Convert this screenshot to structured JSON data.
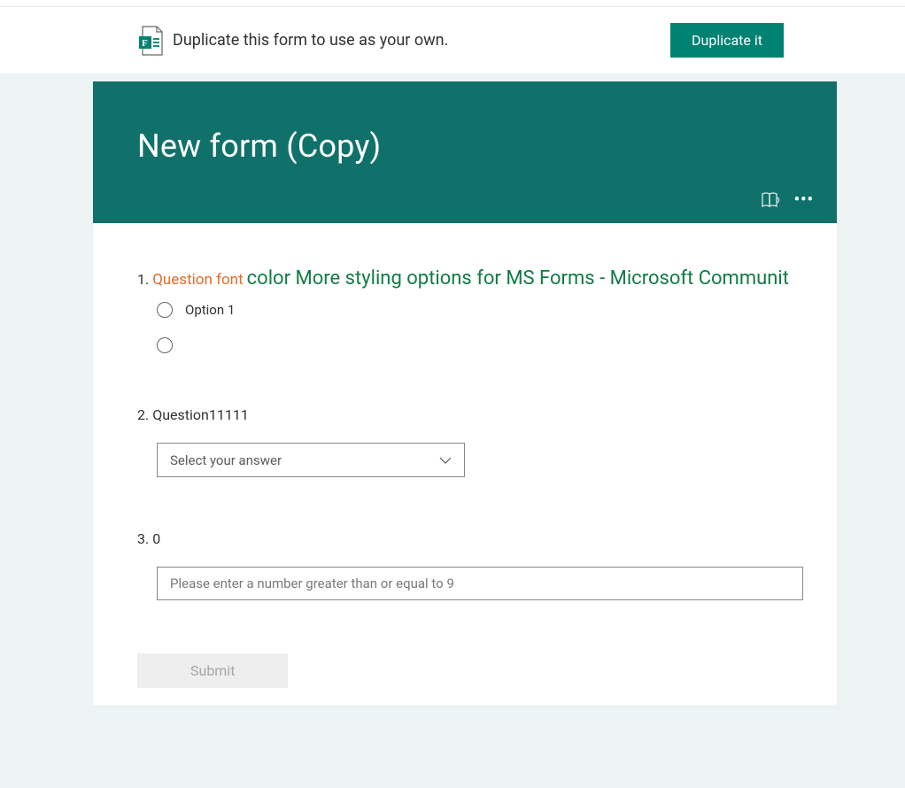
{
  "colors": {
    "brand": "#008272",
    "header_bg": "#10716a",
    "q1_orange": "#df6b28",
    "q1_green": "#107c46"
  },
  "banner": {
    "message": "Duplicate this form to use as your own.",
    "button_label": "Duplicate it"
  },
  "form": {
    "title": "New form (Copy)"
  },
  "q1": {
    "number": "1.",
    "text_part_a": "Question font",
    "text_part_b": "color More styling options for MS Forms - Microsoft Communit",
    "options": [
      {
        "label": "Option 1"
      },
      {
        "label": ""
      }
    ]
  },
  "q2": {
    "number": "2.",
    "text": "Question11111",
    "placeholder": "Select your answer"
  },
  "q3": {
    "number": "3.",
    "text": "0",
    "placeholder": "Please enter a number greater than or equal to 9"
  },
  "submit": {
    "label": "Submit"
  }
}
